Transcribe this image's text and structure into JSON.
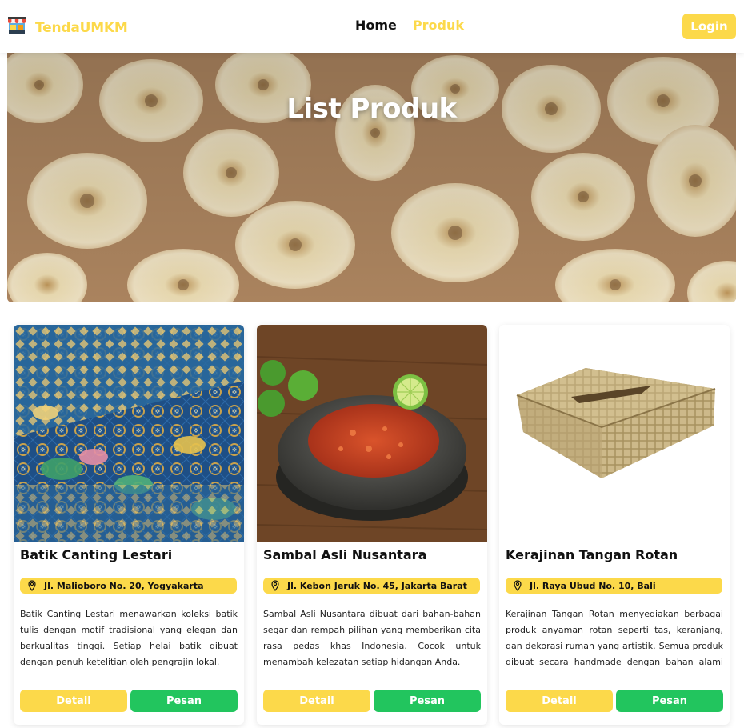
{
  "brand": {
    "name": "TendaUMKM",
    "logo_icon": "market-stall-icon"
  },
  "nav": {
    "home": "Home",
    "produk": "Produk",
    "login": "Login"
  },
  "hero": {
    "title": "List Produk"
  },
  "colors": {
    "accent": "#fcd94a",
    "success": "#22c55e",
    "text": "#111111"
  },
  "products": [
    {
      "title": "Batik Canting Lestari",
      "location": "Jl. Malioboro No. 20, Yogyakarta",
      "description": "Batik Canting Lestari menawarkan koleksi batik tulis dengan motif tradisional yang elegan dan berkualitas tinggi. Setiap helai batik dibuat dengan penuh ketelitian oleh pengrajin lokal.",
      "detail_label": "Detail",
      "order_label": "Pesan"
    },
    {
      "title": "Sambal Asli Nusantara",
      "location": "Jl. Kebon Jeruk No. 45, Jakarta Barat",
      "description": "Sambal Asli Nusantara dibuat dari bahan-bahan segar dan rempah pilihan yang memberikan cita rasa pedas khas Indonesia. Cocok untuk menambah kelezatan setiap hidangan Anda.",
      "detail_label": "Detail",
      "order_label": "Pesan"
    },
    {
      "title": "Kerajinan Tangan Rotan",
      "location": "Jl. Raya Ubud No. 10, Bali",
      "description": "Kerajinan Tangan Rotan menyediakan berbagai produk anyaman rotan seperti tas, keranjang, dan dekorasi rumah yang artistik. Semua produk dibuat secara handmade dengan bahan alami yang ramah lingkungan.",
      "detail_label": "Detail",
      "order_label": "Pesan"
    }
  ]
}
